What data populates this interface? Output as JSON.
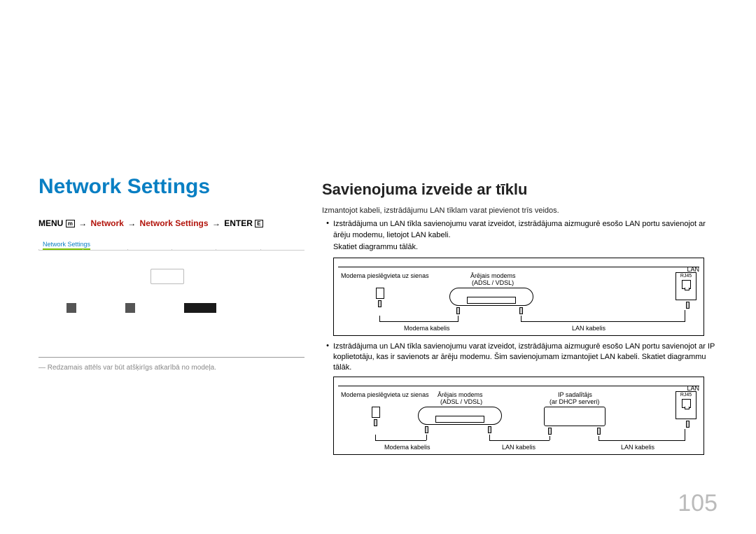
{
  "left": {
    "title": "Network Settings",
    "breadcrumb": {
      "menu": "MENU",
      "network": "Network",
      "network_settings": "Network Settings",
      "enter": "ENTER"
    },
    "screenshot_tab": "Network Settings",
    "footnote": "― Redzamais attēls var būt atšķirīgs atkarībā no modeļa."
  },
  "right": {
    "heading": "Savienojuma izveide ar tīklu",
    "intro": "Izmantojot kabeli, izstrādājumu LAN tīklam varat pievienot trīs veidos.",
    "bullet1": "Izstrādājuma un LAN tīkla savienojumu varat izveidot, izstrādājuma aizmugurē esošo LAN portu savienojot ar ārēju modemu, lietojot LAN kabeli.",
    "see1": "Skatiet diagrammu tālāk.",
    "bullet2": "Izstrādājuma un LAN tīkla savienojumu varat izveidot, izstrādājuma aizmugurē esošo LAN portu savienojot ar IP koplietotāju, kas ir savienots ar ārēju modemu. Šim savienojumam izmantojiet LAN kabeli. Skatiet diagrammu tālāk."
  },
  "diagram1": {
    "wall_label": "Modema pieslēgvieta uz sienas",
    "modem_label": "Ārējais modems",
    "modem_sub": "(ADSL / VDSL)",
    "modem_cable": "Modema kabelis",
    "lan_cable": "LAN kabelis",
    "lan": "LAN",
    "rj45": "RJ45"
  },
  "diagram2": {
    "wall_label": "Modema pieslēgvieta uz sienas",
    "modem_label": "Ārējais modems",
    "modem_sub": "(ADSL / VDSL)",
    "router_label": "IP sadalītājs",
    "router_sub": "(ar DHCP serveri)",
    "modem_cable": "Modema kabelis",
    "lan_cable1": "LAN kabelis",
    "lan_cable2": "LAN kabelis",
    "lan": "LAN",
    "rj45": "RJ45"
  },
  "page_number": "105"
}
